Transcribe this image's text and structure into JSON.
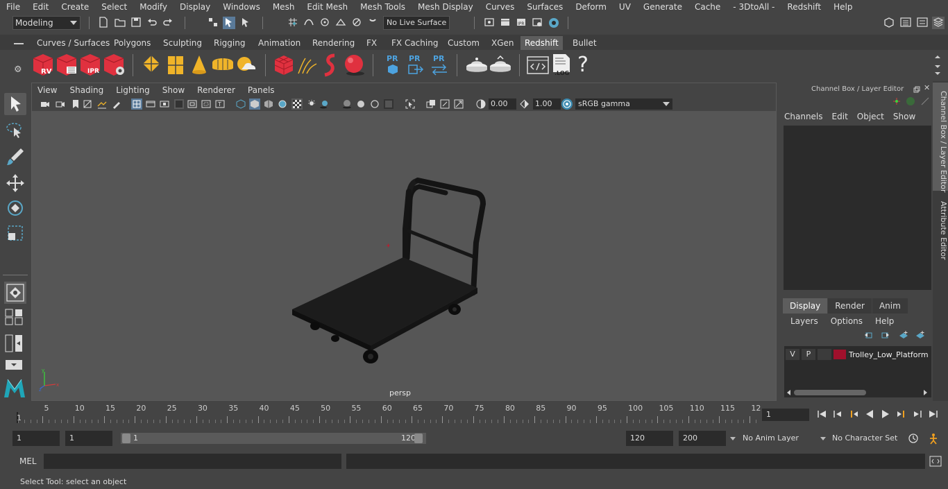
{
  "menubar": [
    "File",
    "Edit",
    "Create",
    "Select",
    "Modify",
    "Display",
    "Windows",
    "Mesh",
    "Edit Mesh",
    "Mesh Tools",
    "Mesh Display",
    "Curves",
    "Surfaces",
    "Deform",
    "UV",
    "Generate",
    "Cache",
    "- 3DtoAll -",
    "Redshift",
    "Help"
  ],
  "status": {
    "mode": "Modeling",
    "live_surface": "No Live Surface"
  },
  "shelf": {
    "tabs": [
      "Curves / Surfaces",
      "Polygons",
      "Sculpting",
      "Rigging",
      "Animation",
      "Rendering",
      "FX",
      "FX Caching",
      "Custom",
      "XGen",
      "Redshift",
      "Bullet"
    ],
    "active_tab": "Redshift",
    "rs_labels": {
      "rv": "RV",
      "ipr": "IPR",
      "pr": "PR",
      "log": ".LOG",
      "help": "?"
    }
  },
  "viewport": {
    "menu": [
      "View",
      "Shading",
      "Lighting",
      "Show",
      "Renderer",
      "Panels"
    ],
    "exposure": "0.00",
    "gamma": "1.00",
    "color_space": "sRGB gamma",
    "camera_label": "persp"
  },
  "channel_box": {
    "title": "Channel Box / Layer Editor",
    "menu": [
      "Channels",
      "Edit",
      "Object",
      "Show"
    ]
  },
  "layer_editor": {
    "tabs": [
      "Display",
      "Render",
      "Anim"
    ],
    "active_tab": "Display",
    "menu": [
      "Layers",
      "Options",
      "Help"
    ],
    "layers": [
      {
        "v": "V",
        "p": "P",
        "name": "Trolley_Low_Platform",
        "color": "#a0102c"
      }
    ]
  },
  "side_tabs": [
    "Channel Box / Layer Editor",
    "Attribute Editor"
  ],
  "timeline": {
    "labels": [
      "5",
      "10",
      "15",
      "20",
      "25",
      "30",
      "35",
      "40",
      "45",
      "50",
      "55",
      "60",
      "65",
      "70",
      "75",
      "80",
      "85",
      "90",
      "95",
      "100",
      "105",
      "110",
      "115",
      "12"
    ],
    "start_label": "1",
    "current_frame": "1"
  },
  "range": {
    "start": "1",
    "playback_start": "1",
    "slider_start": "1",
    "slider_end": "120",
    "playback_end": "120",
    "end": "200",
    "anim_layer": "No Anim Layer",
    "character_set": "No Character Set"
  },
  "command": {
    "language": "MEL"
  },
  "help_line": "Select Tool: select an object"
}
